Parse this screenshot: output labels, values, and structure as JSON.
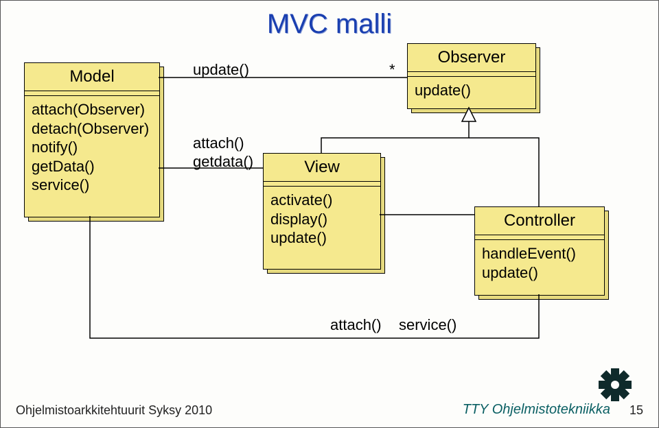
{
  "title": "MVC malli",
  "classes": {
    "model": {
      "name": "Model",
      "ops": [
        "attach(Observer)",
        "detach(Observer)",
        "notify()",
        "getData()",
        "service()"
      ]
    },
    "observer": {
      "name": "Observer",
      "ops": [
        "update()"
      ]
    },
    "view": {
      "name": "View",
      "ops": [
        "activate()",
        "display()",
        "update()"
      ]
    },
    "controller": {
      "name": "Controller",
      "ops": [
        "handleEvent()",
        "update()"
      ]
    }
  },
  "labels": {
    "model_observer_left": "update()",
    "model_observer_mult": "*",
    "model_view_top": "attach()",
    "model_view_bottom": "getdata()",
    "controller_model_left": "attach()",
    "controller_model_right": "service()"
  },
  "footer": {
    "left": "Ohjelmistoarkkitehtuurit Syksy 2010",
    "right": "TTY Ohjelmistotekniikka",
    "page": "15"
  }
}
